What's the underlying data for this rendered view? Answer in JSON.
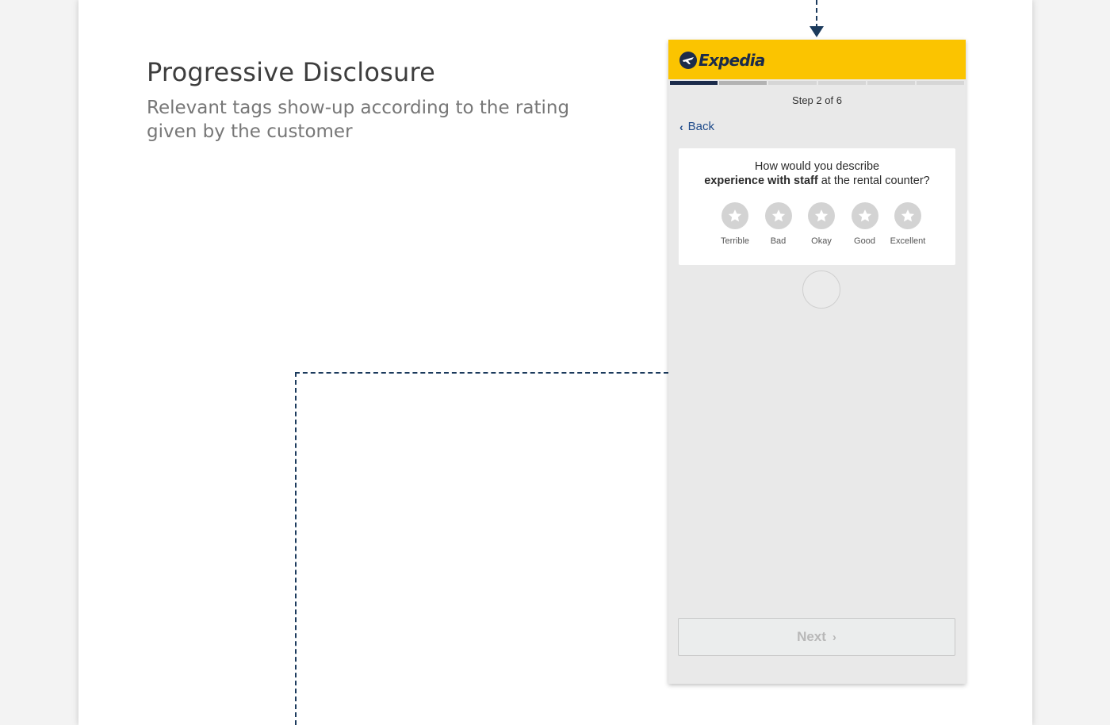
{
  "slide": {
    "title": "Progressive Disclosure",
    "subtitle": "Relevant tags show-up according to the rating given by the customer"
  },
  "app": {
    "brand": "Expedia",
    "brand_color": "#fbc400",
    "brand_dark": "#1b2b4a",
    "step": {
      "current": 2,
      "total": 6,
      "label": "Step 2 of 6"
    },
    "back_label": "Back",
    "question": {
      "line1": "How would you describe",
      "bold": "experience with staff",
      "rest": " at the rental counter?"
    },
    "ratings": [
      {
        "label": "Terrible",
        "icon": "star-icon"
      },
      {
        "label": "Bad",
        "icon": "star-icon"
      },
      {
        "label": "Okay",
        "icon": "star-icon"
      },
      {
        "label": "Good",
        "icon": "star-icon"
      },
      {
        "label": "Excellent",
        "icon": "star-icon"
      }
    ],
    "next_label": "Next"
  }
}
